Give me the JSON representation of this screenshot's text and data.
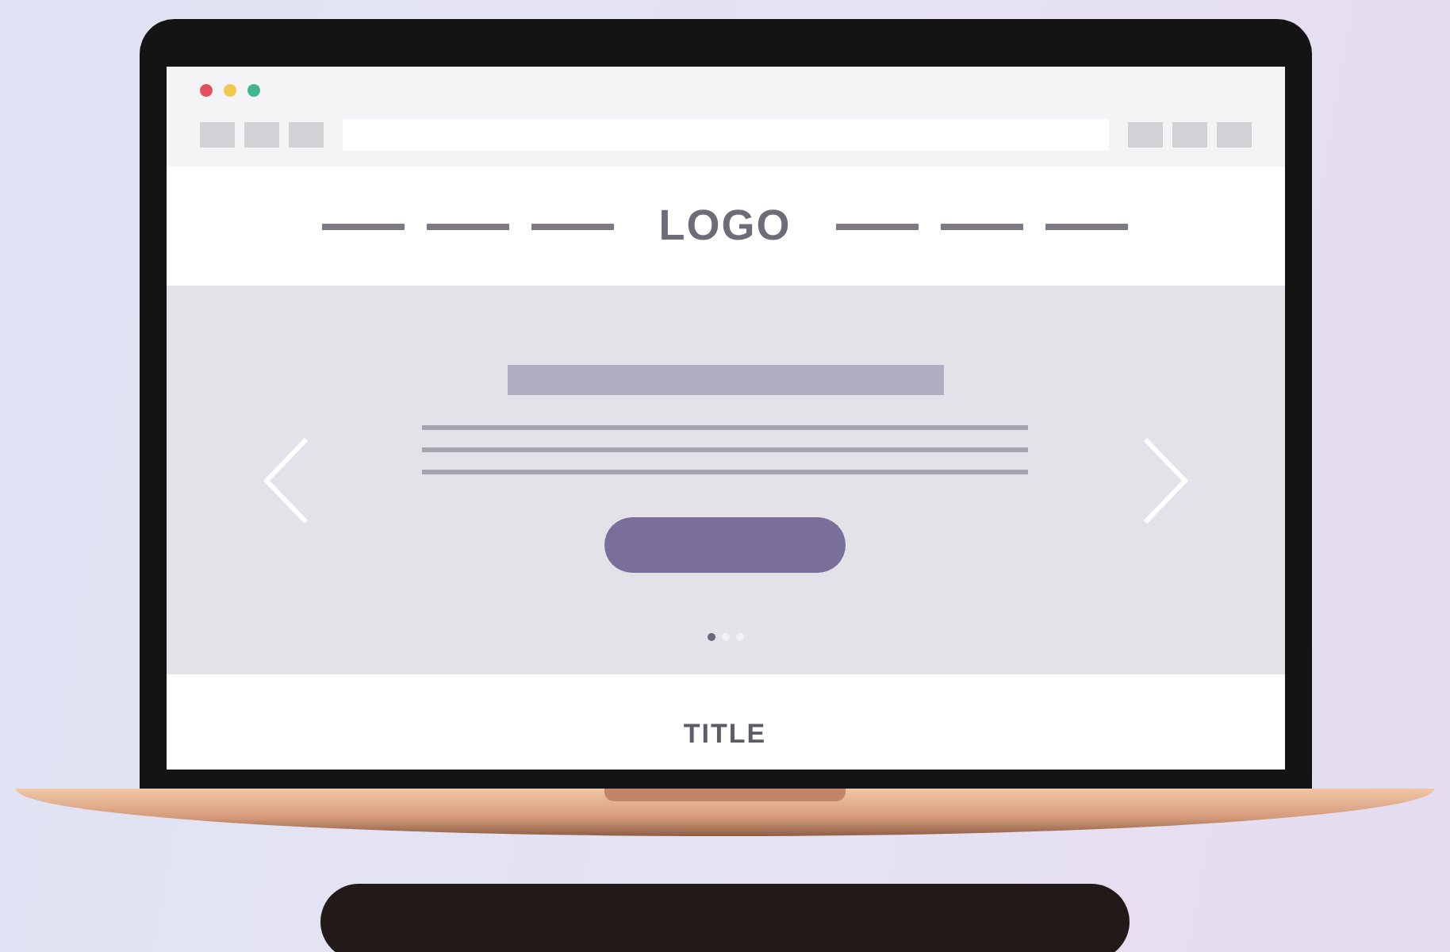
{
  "window_controls": [
    {
      "color": "#e0505f"
    },
    {
      "color": "#f2c94c"
    },
    {
      "color": "#3fb68b"
    }
  ],
  "header": {
    "logo": "LOGO"
  },
  "carousel": {
    "dots": [
      {
        "selected": true
      },
      {
        "selected": false
      },
      {
        "selected": false
      }
    ]
  },
  "section": {
    "title": "TITLE"
  }
}
